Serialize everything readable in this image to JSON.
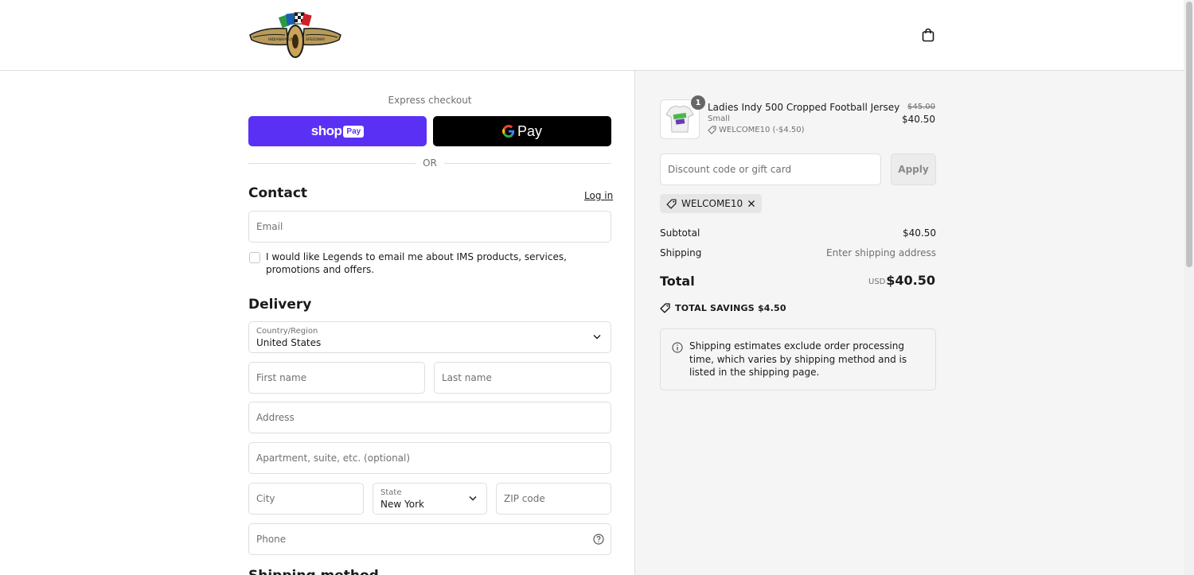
{
  "header": {
    "logo_text_left": "INDIANAPOLIS",
    "logo_text_right": "SPEEDWAY",
    "cart_icon": "shopping-bag-icon"
  },
  "express": {
    "title": "Express checkout",
    "shop_pay_word": "shop",
    "shop_pay_badge": "Pay",
    "gpay_label": "Pay",
    "or_text": "OR"
  },
  "contact": {
    "title": "Contact",
    "login_label": "Log in",
    "email_placeholder": "Email",
    "newsletter_label": "I would like Legends to email me about IMS products, services, promotions and offers.",
    "newsletter_checked": false
  },
  "delivery": {
    "title": "Delivery",
    "country_label": "Country/Region",
    "country_value": "United States",
    "first_name_placeholder": "First name",
    "last_name_placeholder": "Last name",
    "address_placeholder": "Address",
    "apartment_placeholder": "Apartment, suite, etc. (optional)",
    "city_placeholder": "City",
    "state_label": "State",
    "state_value": "New York",
    "zip_placeholder": "ZIP code",
    "phone_placeholder": "Phone",
    "next_section_title": "Shipping method"
  },
  "order": {
    "item": {
      "quantity": "1",
      "name": "Ladies Indy 500 Cropped Football Jersey",
      "variant": "Small",
      "discount": "WELCOME10 (-$4.50)",
      "price_original": "$45.00",
      "price_final": "$40.50"
    },
    "discount_placeholder": "Discount code or gift card",
    "apply_label": "Apply",
    "applied_code": "WELCOME10",
    "subtotal_label": "Subtotal",
    "subtotal_value": "$40.50",
    "shipping_label": "Shipping",
    "shipping_value": "Enter shipping address",
    "total_label": "Total",
    "total_currency": "USD",
    "total_value": "$40.50",
    "savings_text": "TOTAL SAVINGS $4.50",
    "notice_text": "Shipping estimates exclude order processing time, which varies by shipping method and is listed in the shipping page."
  },
  "colors": {
    "shop_pay": "#5a31f4",
    "gpay": "#000000",
    "border": "#dedede",
    "summary_bg": "#f5f5f5"
  }
}
